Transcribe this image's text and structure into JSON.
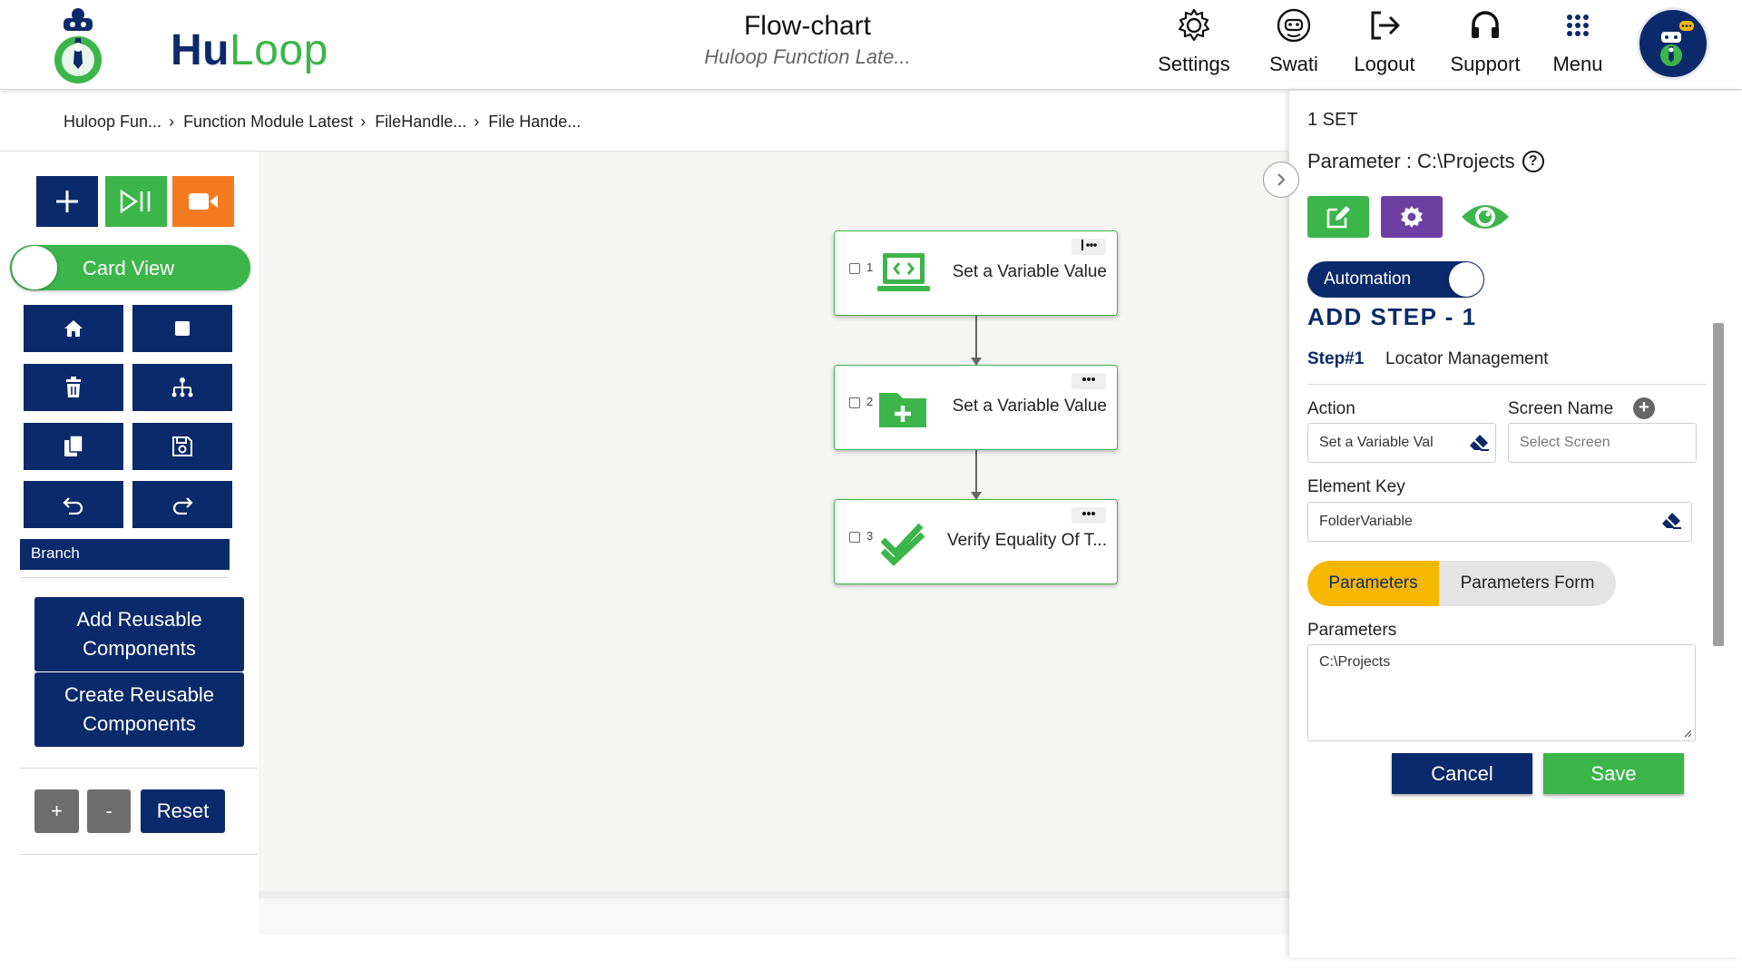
{
  "header": {
    "brand": {
      "hu": "Hu",
      "loop": "Loop"
    },
    "title": "Flow-chart",
    "subtitle": "Huloop Function Late...",
    "nav": [
      {
        "label": "Settings",
        "icon": "gear-icon"
      },
      {
        "label": "Swati",
        "icon": "user-robot-icon"
      },
      {
        "label": "Logout",
        "icon": "logout-icon"
      },
      {
        "label": "Support",
        "icon": "headset-icon"
      },
      {
        "label": "Menu",
        "icon": "grid-menu-icon"
      }
    ]
  },
  "breadcrumb": [
    "Huloop Fun...",
    "Function Module Latest",
    "FileHandle...",
    "File Hande..."
  ],
  "left_toolbar": {
    "card_view_label": "Card View",
    "branch_label": "Branch",
    "add_reusable": "Add Reusable Components",
    "create_reusable": "Create Reusable Components",
    "zoom_in": "+",
    "zoom_out": "-",
    "reset": "Reset"
  },
  "flow": {
    "steps": [
      {
        "number": "1",
        "label": "Set a Variable Value",
        "icon": "laptop-code-icon"
      },
      {
        "number": "2",
        "label": "Set a Variable Value",
        "icon": "folder-plus-icon"
      },
      {
        "number": "3",
        "label": "Verify Equality Of T...",
        "icon": "double-check-icon"
      }
    ]
  },
  "panel": {
    "set_label": "1 SET",
    "parameter_label": "Parameter : C:\\Projects",
    "help": "?",
    "automation_label": "Automation",
    "add_step_title": "ADD STEP - 1",
    "step_number": "Step#1",
    "step_name": "Locator Management",
    "action_label": "Action",
    "action_value": "Set a Variable Val",
    "screen_name_label": "Screen Name",
    "screen_placeholder": "Select Screen",
    "element_key_label": "Element Key",
    "element_key_value": "FolderVariable",
    "tab_parameters": "Parameters",
    "tab_parameters_form": "Parameters Form",
    "parameters_label": "Parameters",
    "parameters_value": "C:\\Projects",
    "cancel": "Cancel",
    "save": "Save"
  },
  "colors": {
    "navy": "#0b2a6b",
    "green": "#3cb54a",
    "orange": "#f37b20",
    "purple": "#6e3fa3",
    "yellow": "#f5b700"
  }
}
